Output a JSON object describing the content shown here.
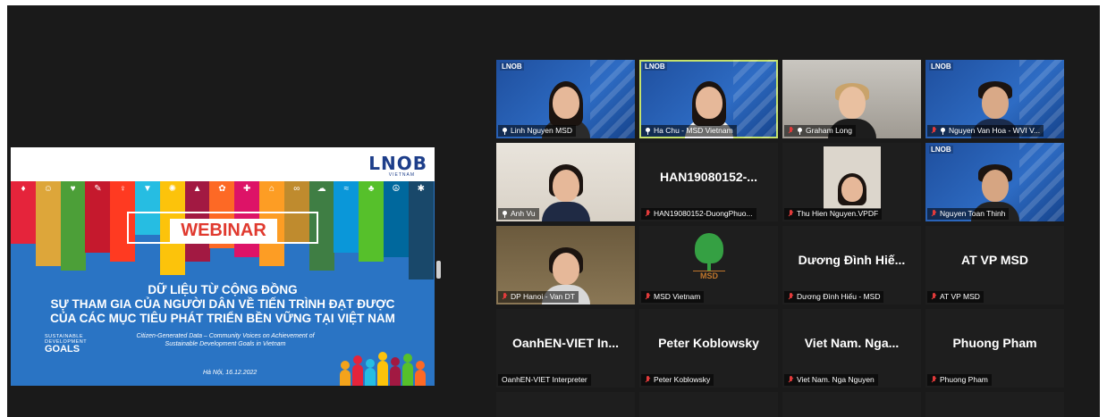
{
  "slide": {
    "logo": "LNOB",
    "logo_sub": "VIETNAM",
    "webinar": "WEBINAR",
    "vn_title_1": "DỮ LIỆU TỪ CỘNG ĐỒNG",
    "vn_title_2": "SỰ THAM GIA CỦA NGƯỜI DÂN VỀ TIẾN TRÌNH ĐẠT ĐƯỢC",
    "vn_title_3": "CỦA CÁC MỤC TIÊU PHÁT TRIỂN BỀN VỮNG TẠI VIỆT NAM",
    "en_title_1": "Citizen-Generated Data – Community Voices on Achievement of",
    "en_title_2": "Sustainable Development Goals in Vietnam",
    "date": "Hà Nội, 16.12.2022",
    "sdg_line_1": "SUSTAINABLE",
    "sdg_line_2": "DEVELOPMENT",
    "sdg_line_3": "GOALS",
    "sdg_colors": [
      "#e5243b",
      "#dda63a",
      "#4c9f38",
      "#c5192d",
      "#ff3a21",
      "#26bde2",
      "#fcc30b",
      "#a21942",
      "#fd6925",
      "#dd1367",
      "#fd9d24",
      "#bf8b2e",
      "#3f7e44",
      "#0a97d9",
      "#56c02b",
      "#00689d",
      "#19486a"
    ]
  },
  "tiles": [
    {
      "name": "Linh Nguyen MSD",
      "icon": "interpreter-icon",
      "logo": "LNOB"
    },
    {
      "name": "Ha Chu - MSD Vietnam",
      "icon": "interpreter-icon",
      "logo": "LNOB"
    },
    {
      "name": "Graham Long",
      "icon": "mic-muted-icon"
    },
    {
      "name": "Nguyen Van Hoa - WVI V...",
      "icon": "mic-muted-icon",
      "logo": "LNOB"
    },
    {
      "name": "Anh Vu",
      "icon": "interpreter-icon"
    },
    {
      "name": "HAN19080152-DuongPhuo...",
      "center": "HAN19080152-...",
      "icon": "mic-muted-icon"
    },
    {
      "name": "Thu Hien Nguyen.VPDF",
      "icon": "mic-muted-icon"
    },
    {
      "name": "Nguyen Toan Thinh",
      "icon": "mic-muted-icon",
      "logo": "LNOB"
    },
    {
      "name": "DP Hanoi - Van DT",
      "icon": "mic-muted-icon"
    },
    {
      "name": "MSD Vietnam",
      "icon": "mic-muted-icon",
      "tree_label": "MSD"
    },
    {
      "name": "Dương Đình Hiếu - MSD",
      "center": "Dương Đình Hiế...",
      "icon": "mic-muted-icon"
    },
    {
      "name": "AT VP MSD",
      "center": "AT VP MSD",
      "icon": "mic-muted-icon"
    },
    {
      "name": "OanhEN-VIET Interpreter",
      "center": "OanhEN-VIET In..."
    },
    {
      "name": "Peter Koblowsky",
      "center": "Peter Koblowsky",
      "icon": "mic-muted-icon"
    },
    {
      "name": "Viet Nam. Nga Nguyen",
      "center": "Viet Nam. Nga...",
      "icon": "mic-muted-icon"
    },
    {
      "name": "Phuong Pham",
      "center": "Phuong Pham",
      "icon": "mic-muted-icon"
    }
  ]
}
